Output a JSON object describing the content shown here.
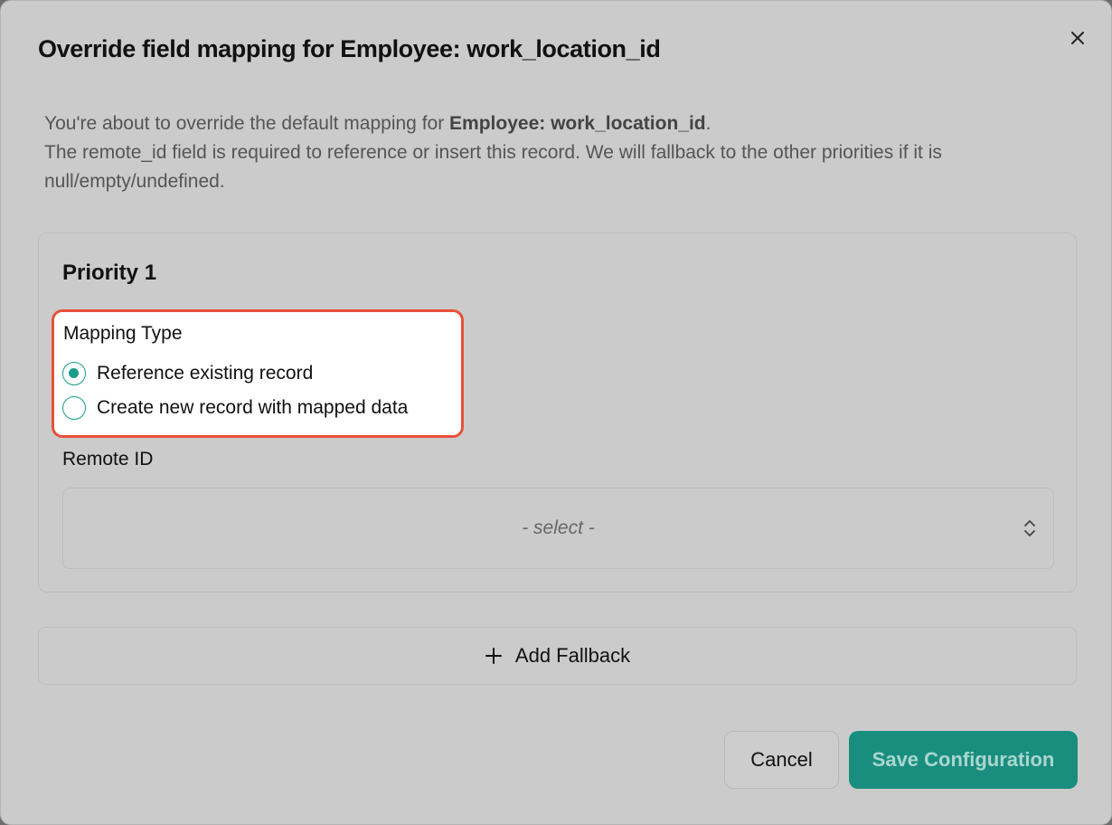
{
  "dialog": {
    "title": "Override field mapping for Employee: work_location_id",
    "description": {
      "line1_prefix": "You're about to override the default mapping for ",
      "line1_bold": "Employee: work_location_id",
      "line1_suffix": ".",
      "line2": "The remote_id field is required to reference or insert this record. We will fallback to the other priorities if it is null/empty/undefined."
    }
  },
  "priority": {
    "title": "Priority 1",
    "mapping_type": {
      "label": "Mapping Type",
      "options": [
        {
          "label": "Reference existing record",
          "selected": true
        },
        {
          "label": "Create new record with mapped data",
          "selected": false
        }
      ]
    },
    "remote_id": {
      "label": "Remote ID",
      "value": "- select -"
    }
  },
  "add_fallback": {
    "label": "Add Fallback"
  },
  "footer": {
    "cancel_label": "Cancel",
    "save_label": "Save Configuration"
  },
  "colors": {
    "accent": "#1a9c8a",
    "save_button": "#1a8e7e",
    "highlight_border": "#e8503a"
  },
  "icons": {
    "close": "close-icon",
    "chevron": "chevron-up-down-icon",
    "plus": "plus-icon"
  }
}
